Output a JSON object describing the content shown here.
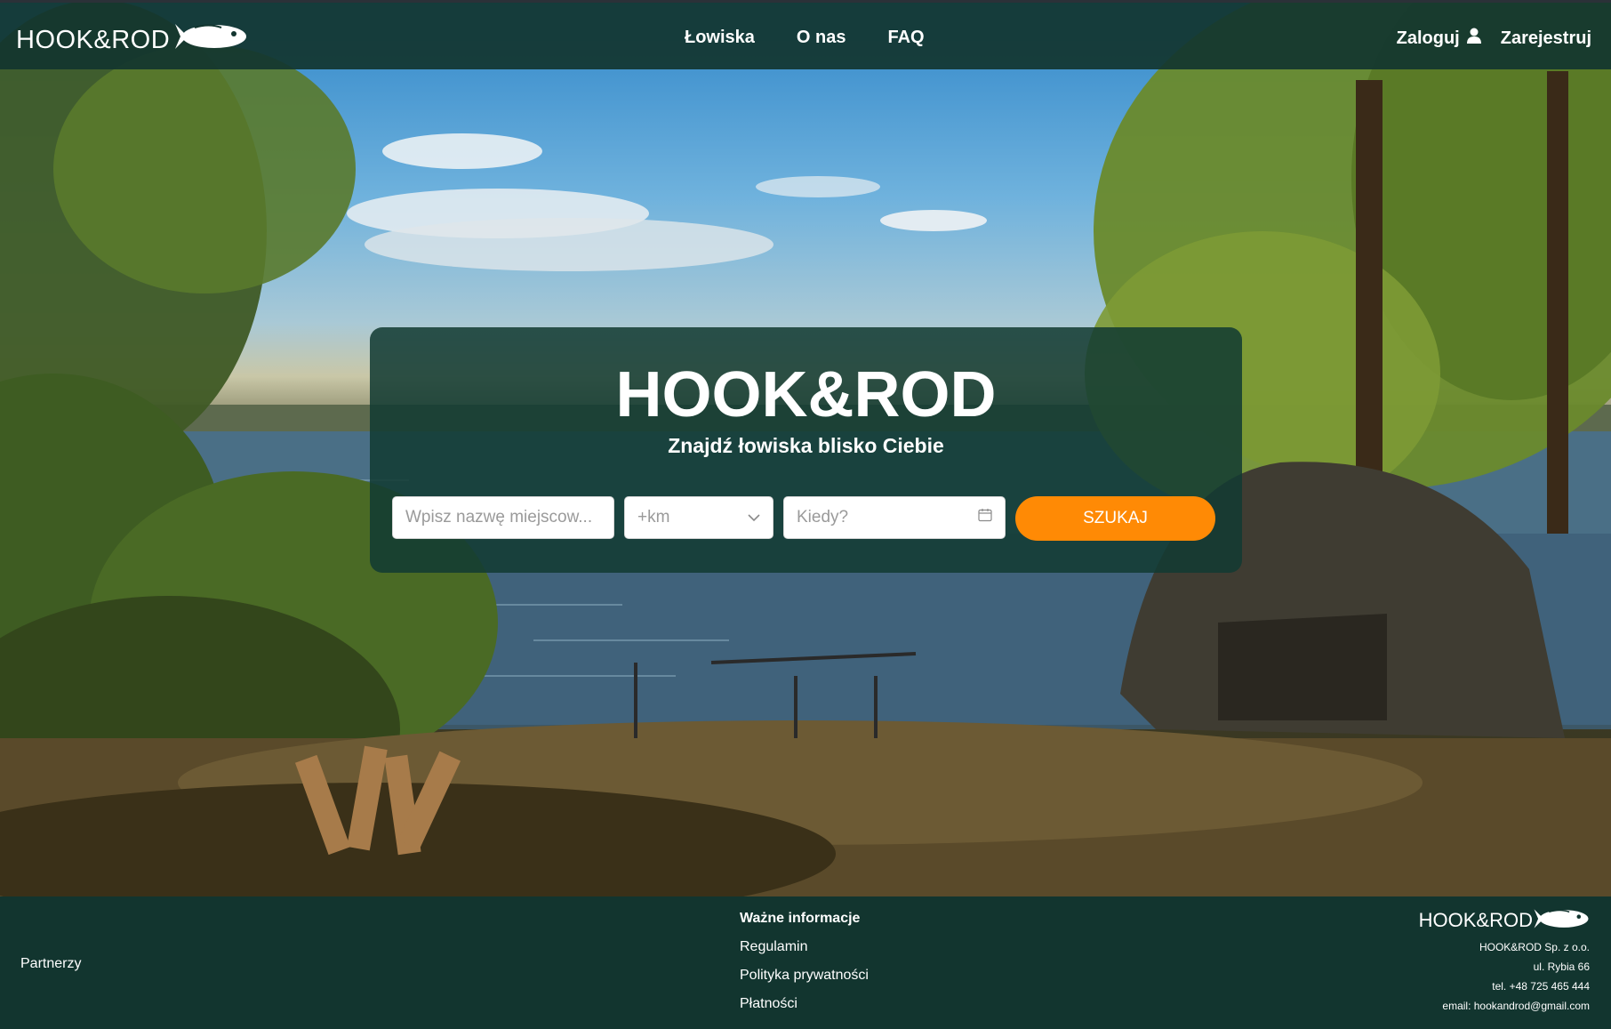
{
  "brand": {
    "name": "HOOK&ROD",
    "icon": "fish-icon"
  },
  "nav": {
    "links": [
      {
        "label": "Łowiska"
      },
      {
        "label": "O nas"
      },
      {
        "label": "FAQ"
      }
    ],
    "login_label": "Zaloguj",
    "login_icon": "user-icon",
    "register_label": "Zarejestruj"
  },
  "hero": {
    "title": "HOOK&ROD",
    "subtitle": "Znajdź łowiska blisko Ciebie"
  },
  "search": {
    "place_placeholder": "Wpisz nazwę miejscow...",
    "distance_placeholder": "+km",
    "date_placeholder": "Kiedy?",
    "button_label": "SZUKAJ"
  },
  "footer": {
    "partners_label": "Partnerzy",
    "info_heading": "Ważne informacje",
    "links": [
      {
        "label": "Regulamin"
      },
      {
        "label": "Polityka prywatności"
      },
      {
        "label": "Płatności"
      }
    ],
    "company": {
      "brand": "HOOK&ROD",
      "name": "HOOK&ROD Sp. z o.o.",
      "address": "ul. Rybia 66",
      "phone": "tel. +48 725 465 444",
      "email": "email: hookandrod@gmail.com"
    }
  },
  "colors": {
    "primary": "#12352f",
    "accent": "#ff8a05"
  }
}
